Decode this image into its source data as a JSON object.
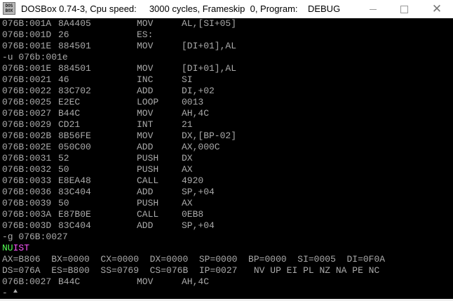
{
  "window": {
    "title": "DOSBox 0.74-3, Cpu speed:     3000 cycles, Frameskip  0, Program:    DEBUG",
    "icon_label_top": "DOS",
    "icon_label_bottom": "BOX",
    "icon": "dosbox-logo-icon",
    "minimize_icon": "minimize-icon",
    "maximize_icon": "maximize-icon",
    "close_icon": "close-icon",
    "close_glyph": "✕"
  },
  "colors": {
    "text": "#aaaaaa",
    "background": "#000000",
    "brand_green": "#55ff55",
    "brand_magenta": "#ff55ff"
  },
  "lines": [
    {
      "addr": "076B:001A",
      "bytes": "8A4405",
      "op": "MOV",
      "args": "AL,[SI+05]"
    },
    {
      "addr": "076B:001D",
      "bytes": "26",
      "op": "ES:",
      "args": ""
    },
    {
      "addr": "076B:001E",
      "bytes": "884501",
      "op": "MOV",
      "args": "[DI+01],AL"
    },
    {
      "text": "-u 076b:001e"
    },
    {
      "addr": "076B:001E",
      "bytes": "884501",
      "op": "MOV",
      "args": "[DI+01],AL"
    },
    {
      "addr": "076B:0021",
      "bytes": "46",
      "op": "INC",
      "args": "SI"
    },
    {
      "addr": "076B:0022",
      "bytes": "83C702",
      "op": "ADD",
      "args": "DI,+02"
    },
    {
      "addr": "076B:0025",
      "bytes": "E2EC",
      "op": "LOOP",
      "args": "0013"
    },
    {
      "addr": "076B:0027",
      "bytes": "B44C",
      "op": "MOV",
      "args": "AH,4C"
    },
    {
      "addr": "076B:0029",
      "bytes": "CD21",
      "op": "INT",
      "args": "21"
    },
    {
      "addr": "076B:002B",
      "bytes": "8B56FE",
      "op": "MOV",
      "args": "DX,[BP-02]"
    },
    {
      "addr": "076B:002E",
      "bytes": "050C00",
      "op": "ADD",
      "args": "AX,000C"
    },
    {
      "addr": "076B:0031",
      "bytes": "52",
      "op": "PUSH",
      "args": "DX"
    },
    {
      "addr": "076B:0032",
      "bytes": "50",
      "op": "PUSH",
      "args": "AX"
    },
    {
      "addr": "076B:0033",
      "bytes": "E8EA48",
      "op": "CALL",
      "args": "4920"
    },
    {
      "addr": "076B:0036",
      "bytes": "83C404",
      "op": "ADD",
      "args": "SP,+04"
    },
    {
      "addr": "076B:0039",
      "bytes": "50",
      "op": "PUSH",
      "args": "AX"
    },
    {
      "addr": "076B:003A",
      "bytes": "E87B0E",
      "op": "CALL",
      "args": "0EB8"
    },
    {
      "addr": "076B:003D",
      "bytes": "83C404",
      "op": "ADD",
      "args": "SP,+04"
    },
    {
      "text": "-g 076B:0027"
    },
    {
      "brand": true,
      "part1": "NU",
      "part2": "IST"
    },
    {
      "text": "AX=B806  BX=0000  CX=0000  DX=0000  SP=0000  BP=0000  SI=0005  DI=0F0A"
    },
    {
      "text": "DS=076A  ES=B800  SS=0769  CS=076B  IP=0027   NV UP EI PL NZ NA PE NC"
    },
    {
      "addr": "076B:0027",
      "bytes": "B44C",
      "op": "MOV",
      "args": "AH,4C"
    },
    {
      "text": "-"
    }
  ],
  "cursor_icon": "mouse-pointer-icon"
}
